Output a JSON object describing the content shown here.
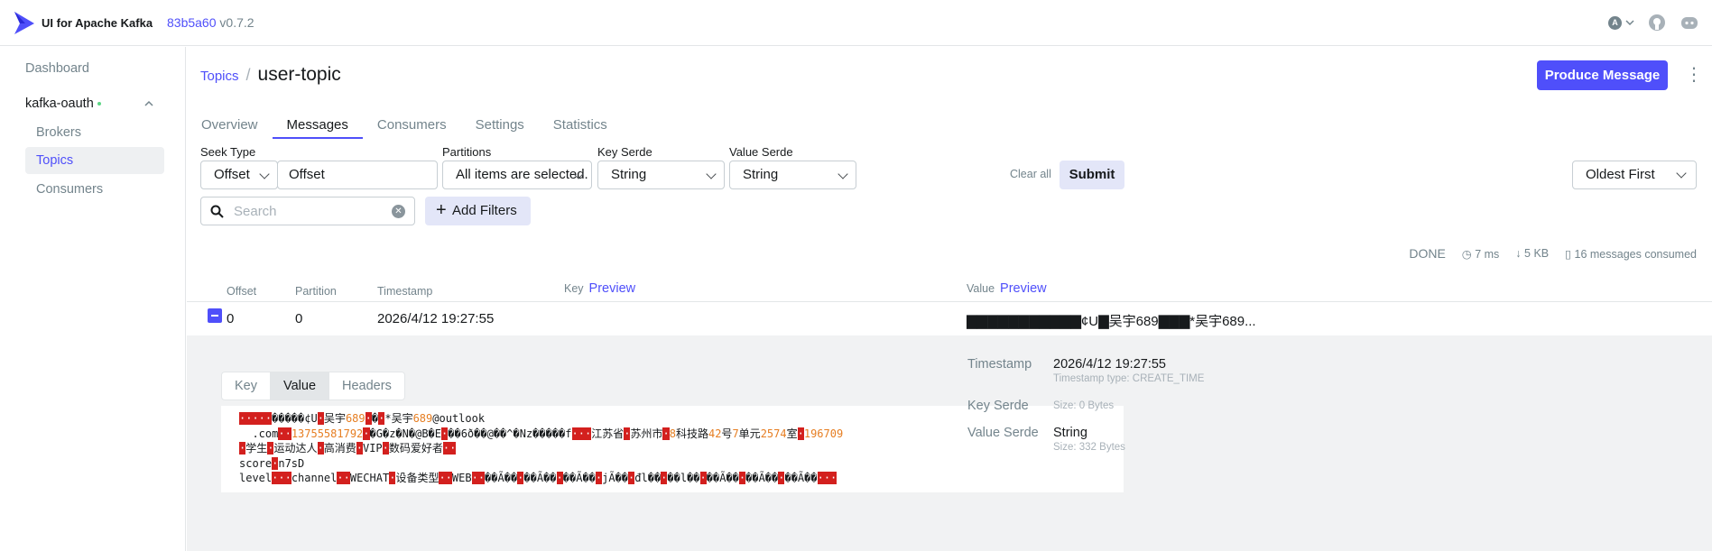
{
  "header": {
    "app_title": "UI for Apache Kafka",
    "commit": "83b5a60",
    "version": "v0.7.2",
    "user_initial": "A"
  },
  "sidebar": {
    "dashboard": "Dashboard",
    "cluster": "kafka-oauth",
    "items": [
      {
        "label": "Brokers"
      },
      {
        "label": "Topics"
      },
      {
        "label": "Consumers"
      }
    ]
  },
  "breadcrumb": {
    "parent": "Topics",
    "current": "user-topic"
  },
  "actions": {
    "produce": "Produce Message"
  },
  "tabs": [
    "Overview",
    "Messages",
    "Consumers",
    "Settings",
    "Statistics"
  ],
  "filters": {
    "seek_type_label": "Seek Type",
    "seek_type_value": "Offset",
    "offset_value": "Offset",
    "partitions_label": "Partitions",
    "partitions_value": "All items are selected.",
    "key_serde_label": "Key Serde",
    "key_serde_value": "String",
    "value_serde_label": "Value Serde",
    "value_serde_value": "String",
    "clear_all": "Clear all",
    "submit": "Submit",
    "sort": "Oldest First",
    "search_placeholder": "Search",
    "add_filters": "Add Filters"
  },
  "stats": {
    "status": "DONE",
    "time": "7 ms",
    "size": "5 KB",
    "consumed": "16 messages consumed"
  },
  "table": {
    "headers": {
      "offset": "Offset",
      "partition": "Partition",
      "timestamp": "Timestamp",
      "key": "Key",
      "value": "Value",
      "preview": "Preview"
    },
    "row": {
      "offset": "0",
      "partition": "0",
      "timestamp": "2026/4/12 19:27:55",
      "value": "▇▇▇▇▇▇▇▇▇▇▇¢U▇吴宇689▇▇▇*吴宇689..."
    }
  },
  "detail": {
    "tabs": [
      "Key",
      "Value",
      "Headers"
    ],
    "timestamp_label": "Timestamp",
    "timestamp_value": "2026/4/12 19:27:55",
    "timestamp_type": "Timestamp type: CREATE_TIME",
    "key_serde_label": "Key Serde",
    "key_size": "Size: 0 Bytes",
    "value_serde_label": "Value Serde",
    "value_serde_value": "String",
    "value_size": "Size: 332 Bytes"
  }
}
